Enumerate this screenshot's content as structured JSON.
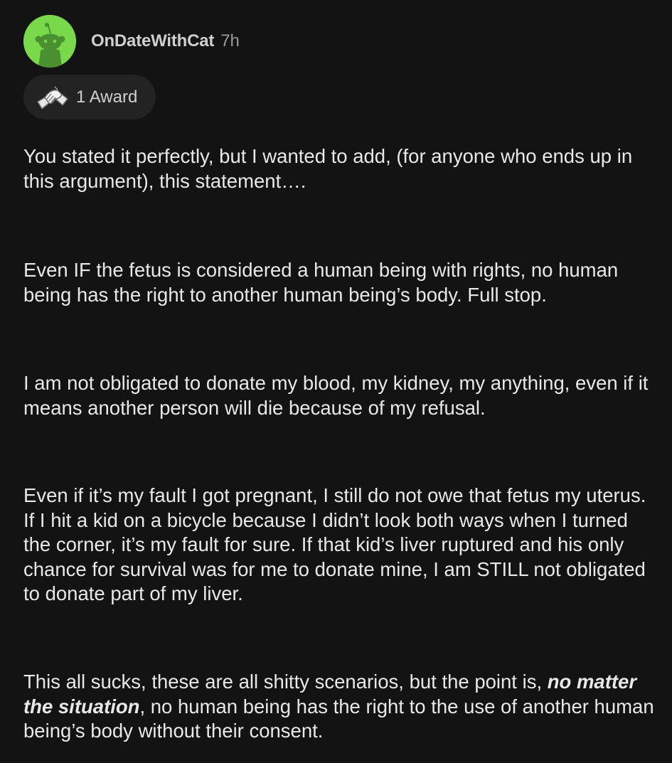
{
  "comment": {
    "author": "OnDateWithCat",
    "age": "7h",
    "award_label": "1 Award",
    "avatar_icon": "snoo-avatar-icon",
    "award_icon": "handshake-award-icon",
    "avatar_color": "#7ad84b",
    "paragraphs": [
      "You stated it perfectly, but I wanted to add, (for anyone who ends up in this argument), this statement….",
      "Even IF the fetus is considered a human being with rights, no human being has the right to another human being’s body. Full stop.",
      "I am not obligated to donate my blood, my kidney, my anything, even if it means another person will die because of my refusal.",
      "Even if it’s my fault I got pregnant, I still do not owe that fetus my uterus. If I hit a kid on a bicycle because I didn’t look both ways when I turned the corner, it’s my fault for sure. If that kid’s liver ruptured and his only chance for survival was for me to donate mine, I am STILL not obligated to donate part of my liver."
    ],
    "last_paragraph": {
      "before": "This all sucks, these are all shitty scenarios, but the point is, ",
      "emphasis": "no matter the situation",
      "after": ", no human being has the right to the use of another human being’s body without their consent."
    }
  }
}
